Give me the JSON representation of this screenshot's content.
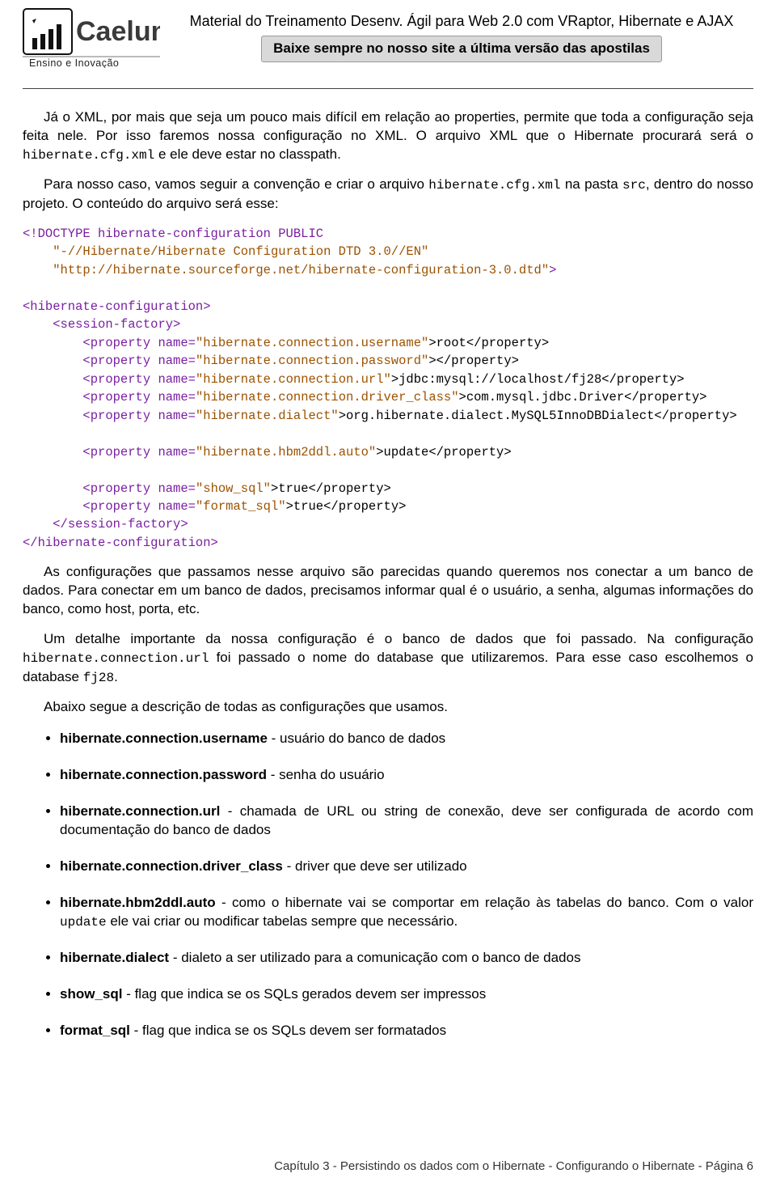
{
  "header": {
    "logo_company": "Caelum",
    "logo_tagline": "Ensino e Inovação",
    "title": "Material do Treinamento Desenv. Ágil para Web 2.0 com VRaptor, Hibernate e AJAX",
    "banner": "Baixe sempre no nosso site a última versão das apostilas"
  },
  "para1": {
    "a": "Já o XML, por mais que seja um pouco mais difícil em relação ao properties, permite que toda a configuração seja feita nele. Por isso faremos nossa configuração no XML. O arquivo XML que o Hibernate procurará será o ",
    "code1": "hibernate.cfg.xml",
    "b": " e ele deve estar no classpath."
  },
  "para2": {
    "a": "Para nosso caso, vamos seguir a convenção e criar o arquivo ",
    "code1": "hibernate.cfg.xml",
    "b": " na pasta ",
    "code2": "src",
    "c": ", dentro do nosso projeto. O conteúdo do arquivo será esse:"
  },
  "code": {
    "l1a": "<!DOCTYPE hibernate-configuration PUBLIC",
    "l2a": "\"-//Hibernate/Hibernate Configuration DTD 3.0//EN\"",
    "l3a": "\"http://hibernate.sourceforge.net/hibernate-configuration-3.0.dtd\"",
    "l3b": ">",
    "l5a": "<hibernate-configuration>",
    "l6a": "<session-factory>",
    "l7a": "<property",
    "l7b": "name=",
    "l7c": "\"hibernate.connection.username\"",
    "l7d": ">root</property>",
    "l8c": "\"hibernate.connection.password\"",
    "l8d": "></property>",
    "l9c": "\"hibernate.connection.url\"",
    "l9d": ">jdbc:mysql://localhost/fj28</property>",
    "l10c": "\"hibernate.connection.driver_class\"",
    "l10d": ">com.mysql.jdbc.Driver</property>",
    "l11c": "\"hibernate.dialect\"",
    "l11d": ">org.hibernate.dialect.MySQL5InnoDBDialect</property>",
    "l13c": "\"hibernate.hbm2ddl.auto\"",
    "l13d": ">update</property>",
    "l15c": "\"show_sql\"",
    "l15d": ">true</property>",
    "l16c": "\"format_sql\"",
    "l16d": ">true</property>",
    "l17a": "</session-factory>",
    "l18a": "</hibernate-configuration>"
  },
  "para3": "As configurações que passamos nesse arquivo são parecidas quando queremos nos conectar a um banco de dados. Para conectar em um banco de dados, precisamos informar qual é o usuário, a senha, algumas informações do banco, como host, porta, etc.",
  "para4": {
    "a": "Um detalhe importante da nossa configuração é o banco de dados que foi passado.  Na configuração ",
    "code1": "hibernate.connection.url",
    "b": " foi passado o nome do database que utilizaremos.  Para esse caso escolhemos o database ",
    "code2": "fj28",
    "c": "."
  },
  "para5": "Abaixo segue a descrição de todas as configurações que usamos.",
  "bullets": {
    "b1a": "hibernate.connection.username",
    "b1b": " - usuário do banco de dados",
    "b2a": "hibernate.connection.password",
    "b2b": " - senha do usuário",
    "b3a": "hibernate.connection.url",
    "b3b": " - chamada de URL ou string de conexão, deve ser configurada de acordo com documentação do banco de dados",
    "b4a": "hibernate.connection.driver_class",
    "b4b": " - driver que deve ser utilizado",
    "b5a": "hibernate.hbm2ddl.auto",
    "b5b": " - como o hibernate vai se comportar em relação às tabelas do banco. Com o valor ",
    "b5code": "update",
    "b5c": " ele vai criar ou modificar tabelas sempre que necessário.",
    "b6a": "hibernate.dialect",
    "b6b": " - dialeto a ser utilizado para a comunicação com o banco de dados",
    "b7a": "show_sql",
    "b7b": " - flag que indica se os SQLs gerados devem ser impressos",
    "b8a": "format_sql",
    "b8b": " - flag que indica se os SQLs devem ser formatados"
  },
  "footer": "Capítulo 3 - Persistindo os dados com o Hibernate - Configurando o Hibernate - Página 6"
}
